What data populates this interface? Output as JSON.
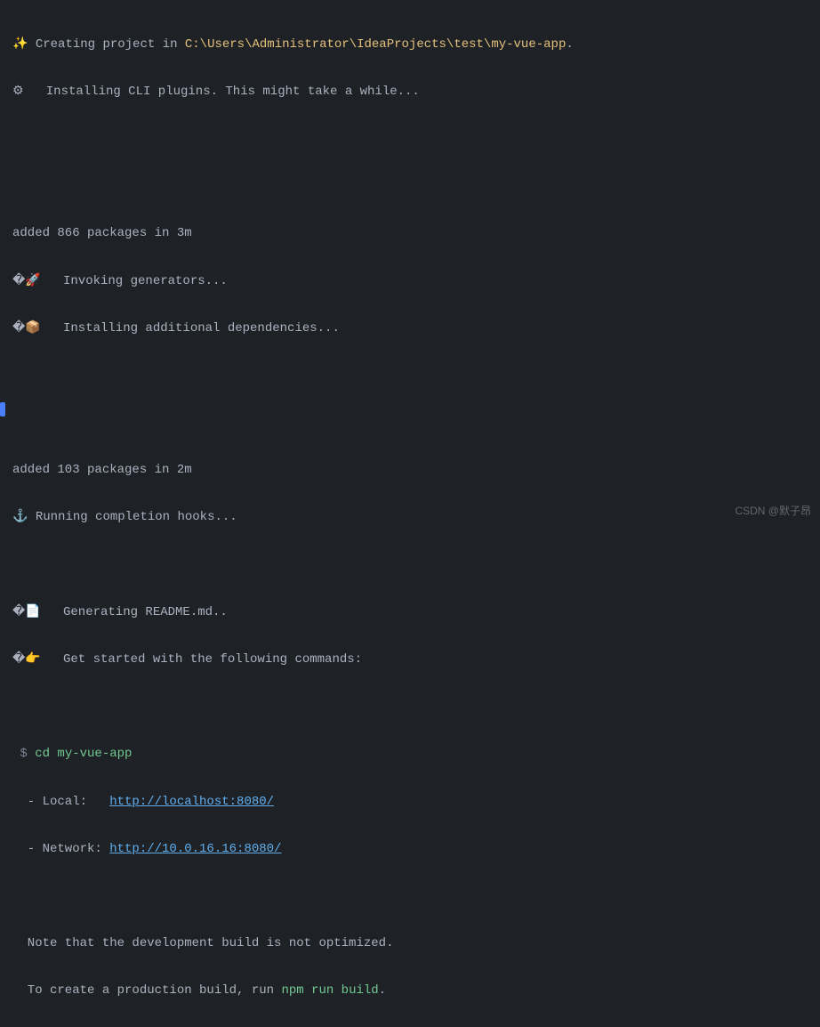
{
  "lines": {
    "l1_icon": "✨",
    "l1_text": " Creating project in ",
    "l1_path": "C:\\Users\\Administrator\\IdeaProjects\\test\\my-vue-app",
    "l1_end": ".",
    "l2_icon": "⚙",
    "l2_text": "   Installing CLI plugins. This might take a while...",
    "l3_text": "added 866 packages in 3m",
    "l4_icon": "�🚀",
    "l4_text": "   Invoking generators...",
    "l5_icon": "�📦",
    "l5_text": "   Installing additional dependencies...",
    "l6_text": "added 103 packages in 2m",
    "l7_icon": "⚓",
    "l7_text": " Running completion hooks...",
    "l8_icon": "�📄",
    "l8_text": "   Generating README.md..",
    "l9_icon": "�👉",
    "l9_text": "   Get started with the following commands:",
    "prompt": " $ ",
    "cd_cmd": "cd my-vue-app",
    "local_prefix": "  - Local:   ",
    "local_url": "http://localhost:8080/",
    "network_prefix": "  - Network: ",
    "network_url": "http://10.0.16.16:8080/",
    "note1": "  Note that the development build is not optimized.",
    "note2a": "  To create a production build, run ",
    "note2b": "npm run build",
    "note2c": "."
  },
  "watermark": "CSDN @默子昂"
}
